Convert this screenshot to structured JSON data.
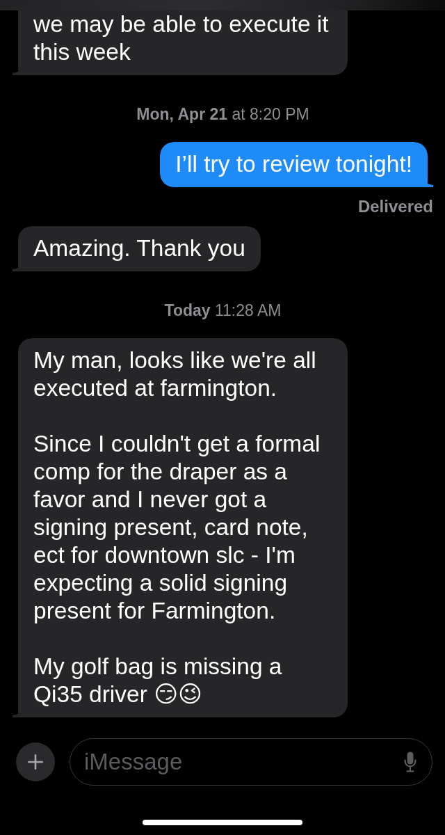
{
  "thread": [
    {
      "kind": "incoming",
      "text": "we may be able to execute it this week"
    },
    {
      "kind": "timestamp",
      "text": "**Mon, Apr 21** at 8:20 PM"
    },
    {
      "kind": "outgoing",
      "text": "I’ll try to review tonight!"
    },
    {
      "kind": "status",
      "text": "Delivered"
    },
    {
      "kind": "incoming",
      "text": "Amazing. Thank you"
    },
    {
      "kind": "timestamp",
      "text": "**Today** 11:28 AM"
    },
    {
      "kind": "incoming",
      "text": "My man, looks like we're all executed at farmington.\n\nSince I couldn't get a formal comp for the draper as a favor and I never got a signing present, card note, ect for downtown slc - I'm expecting a solid signing present for Farmington.\n\nMy golf bag is missing a Qi35 driver 😏😉"
    }
  ],
  "composer": {
    "placeholder": "iMessage"
  }
}
